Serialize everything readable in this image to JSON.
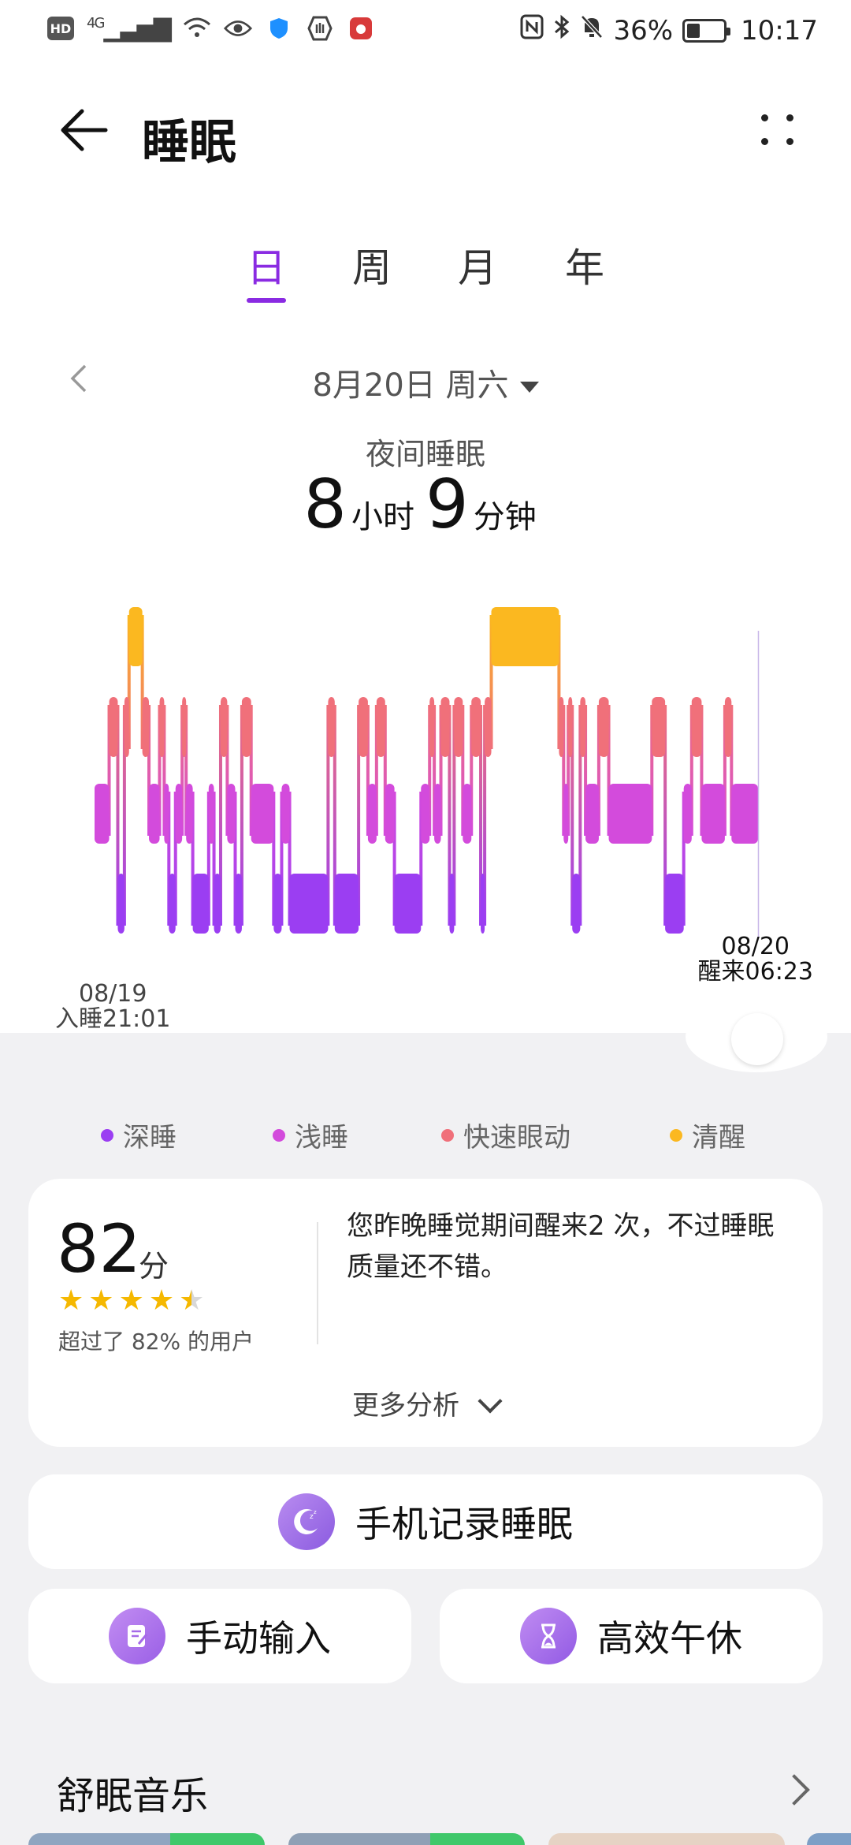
{
  "status_bar": {
    "hd": "HD",
    "network": "4G",
    "battery": "36%",
    "battery_level": 0.36,
    "time": "10:17"
  },
  "header": {
    "title": "睡眠",
    "back_icon": "back-arrow-icon",
    "more_icon": "more-dots-icon"
  },
  "tabs": [
    {
      "label": "日",
      "active": true
    },
    {
      "label": "周",
      "active": false
    },
    {
      "label": "月",
      "active": false
    },
    {
      "label": "年",
      "active": false
    }
  ],
  "date_nav": {
    "date": "8月20日 周六"
  },
  "summary": {
    "type": "夜间睡眠",
    "hours": "8",
    "hours_unit": "小时",
    "minutes": "9",
    "minutes_unit": "分钟"
  },
  "chart": {
    "start_date": "08/19",
    "start_label": "入睡21:01",
    "end_date": "08/20",
    "end_label": "醒来06:23"
  },
  "chart_data": {
    "type": "bar",
    "stage_levels": [
      "深睡",
      "浅睡",
      "快速眼动",
      "清醒"
    ],
    "segments": [
      {
        "stage": "浅睡",
        "start": 0.0,
        "end": 0.022
      },
      {
        "stage": "快速眼动",
        "start": 0.022,
        "end": 0.035
      },
      {
        "stage": "深睡",
        "start": 0.035,
        "end": 0.045
      },
      {
        "stage": "快速眼动",
        "start": 0.045,
        "end": 0.052
      },
      {
        "stage": "清醒",
        "start": 0.052,
        "end": 0.072
      },
      {
        "stage": "快速眼动",
        "start": 0.072,
        "end": 0.082
      },
      {
        "stage": "浅睡",
        "start": 0.082,
        "end": 0.098
      },
      {
        "stage": "快速眼动",
        "start": 0.098,
        "end": 0.105
      },
      {
        "stage": "浅睡",
        "start": 0.105,
        "end": 0.112
      },
      {
        "stage": "深睡",
        "start": 0.112,
        "end": 0.122
      },
      {
        "stage": "浅睡",
        "start": 0.122,
        "end": 0.132
      },
      {
        "stage": "快速眼动",
        "start": 0.132,
        "end": 0.138
      },
      {
        "stage": "浅睡",
        "start": 0.138,
        "end": 0.148
      },
      {
        "stage": "深睡",
        "start": 0.148,
        "end": 0.172
      },
      {
        "stage": "浅睡",
        "start": 0.172,
        "end": 0.18
      },
      {
        "stage": "深睡",
        "start": 0.18,
        "end": 0.19
      },
      {
        "stage": "快速眼动",
        "start": 0.19,
        "end": 0.2
      },
      {
        "stage": "浅睡",
        "start": 0.2,
        "end": 0.212
      },
      {
        "stage": "深睡",
        "start": 0.212,
        "end": 0.222
      },
      {
        "stage": "快速眼动",
        "start": 0.222,
        "end": 0.236
      },
      {
        "stage": "浅睡",
        "start": 0.236,
        "end": 0.27
      },
      {
        "stage": "深睡",
        "start": 0.27,
        "end": 0.282
      },
      {
        "stage": "浅睡",
        "start": 0.282,
        "end": 0.294
      },
      {
        "stage": "深睡",
        "start": 0.294,
        "end": 0.352
      },
      {
        "stage": "快速眼动",
        "start": 0.352,
        "end": 0.362
      },
      {
        "stage": "深睡",
        "start": 0.362,
        "end": 0.398
      },
      {
        "stage": "快速眼动",
        "start": 0.398,
        "end": 0.412
      },
      {
        "stage": "浅睡",
        "start": 0.412,
        "end": 0.425
      },
      {
        "stage": "快速眼动",
        "start": 0.425,
        "end": 0.438
      },
      {
        "stage": "浅睡",
        "start": 0.438,
        "end": 0.452
      },
      {
        "stage": "深睡",
        "start": 0.452,
        "end": 0.492
      },
      {
        "stage": "浅睡",
        "start": 0.492,
        "end": 0.505
      },
      {
        "stage": "快速眼动",
        "start": 0.505,
        "end": 0.512
      },
      {
        "stage": "浅睡",
        "start": 0.512,
        "end": 0.522
      },
      {
        "stage": "快速眼动",
        "start": 0.522,
        "end": 0.535
      },
      {
        "stage": "深睡",
        "start": 0.535,
        "end": 0.542
      },
      {
        "stage": "快速眼动",
        "start": 0.542,
        "end": 0.555
      },
      {
        "stage": "浅睡",
        "start": 0.555,
        "end": 0.568
      },
      {
        "stage": "快速眼动",
        "start": 0.568,
        "end": 0.582
      },
      {
        "stage": "深睡",
        "start": 0.582,
        "end": 0.588
      },
      {
        "stage": "快速眼动",
        "start": 0.588,
        "end": 0.598
      },
      {
        "stage": "清醒",
        "start": 0.598,
        "end": 0.7
      },
      {
        "stage": "快速眼动",
        "start": 0.7,
        "end": 0.707
      },
      {
        "stage": "浅睡",
        "start": 0.707,
        "end": 0.714
      },
      {
        "stage": "快速眼动",
        "start": 0.714,
        "end": 0.72
      },
      {
        "stage": "深睡",
        "start": 0.72,
        "end": 0.732
      },
      {
        "stage": "快速眼动",
        "start": 0.732,
        "end": 0.74
      },
      {
        "stage": "浅睡",
        "start": 0.74,
        "end": 0.76
      },
      {
        "stage": "快速眼动",
        "start": 0.76,
        "end": 0.775
      },
      {
        "stage": "浅睡",
        "start": 0.775,
        "end": 0.84
      },
      {
        "stage": "快速眼动",
        "start": 0.84,
        "end": 0.86
      },
      {
        "stage": "深睡",
        "start": 0.86,
        "end": 0.888
      },
      {
        "stage": "浅睡",
        "start": 0.888,
        "end": 0.9
      },
      {
        "stage": "快速眼动",
        "start": 0.9,
        "end": 0.915
      },
      {
        "stage": "浅睡",
        "start": 0.915,
        "end": 0.95
      },
      {
        "stage": "快速眼动",
        "start": 0.95,
        "end": 0.96
      },
      {
        "stage": "浅睡",
        "start": 0.96,
        "end": 1.0
      }
    ],
    "colors": {
      "深睡": "#9b3ef2",
      "浅睡": "#d34bdc",
      "快速眼动": "#f0707a",
      "清醒": "#fbb820"
    }
  },
  "legend": [
    {
      "label": "深睡",
      "color": "#9b3ef2"
    },
    {
      "label": "浅睡",
      "color": "#d34bdc"
    },
    {
      "label": "快速眼动",
      "color": "#f0707a"
    },
    {
      "label": "清醒",
      "color": "#fbb820"
    }
  ],
  "score": {
    "value": "82",
    "unit": "分",
    "stars": 4.5,
    "rank": "超过了 82% 的用户",
    "description": "您昨晚睡觉期间醒来2 次，不过睡眠质量还不错。",
    "more": "更多分析"
  },
  "actions": {
    "phone_record": "手机记录睡眠",
    "manual_input": "手动输入",
    "nap": "高效午休"
  },
  "music": {
    "title": "舒眠音乐"
  }
}
